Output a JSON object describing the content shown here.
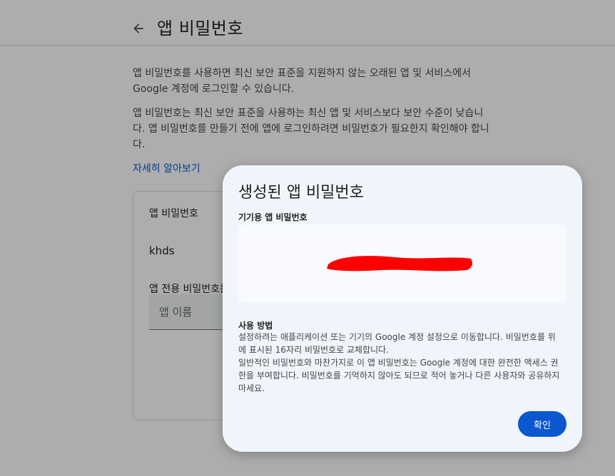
{
  "page": {
    "title": "앱 비밀번호",
    "back_icon": "arrow-left-icon"
  },
  "intro": {
    "paragraph1": "앱 비밀번호를 사용하면 최신 보안 표준을 지원하지 않는 오래된 앱 및 서비스에서 Google 계정에 로그인할 수 있습니다.",
    "paragraph2": "앱 비밀번호는 최신 보안 표준을 사용하는 최신 앱 및 서비스보다 보안 수준이 낮습니다. 앱 비밀번호를 만들기 전에 앱에 로그인하려면 비밀번호가 필요한지 확인해야 합니다.",
    "learn_more": "자세히 알아보기"
  },
  "card": {
    "title": "앱 비밀번호",
    "app_name": "khds",
    "field_label": "앱 전용 비밀번호를",
    "input_placeholder": "앱 이름"
  },
  "dialog": {
    "title": "생성된 앱 비밀번호",
    "password_label": "기기용 앱 비밀번호",
    "redaction_color": "#ff0000",
    "howto_title": "사용 방법",
    "howto_line1": "설정하려는 애플리케이션 또는 기기의 Google 계정 설정으로 이동합니다. 비밀번호를 위에 표시된 16자리 비밀번호로 교체합니다.",
    "howto_line2": "일반적인 비밀번호와 마찬가지로 이 앱 비밀번호는 Google 계정에 대한 완전한 액세스 권한을 부여합니다. 비밀번호를 기억하지 않아도 되므로 적어 놓거나 다른 사용자와 공유하지 마세요.",
    "confirm_label": "확인"
  },
  "colors": {
    "accent": "#0b57d0",
    "dialog_bg": "#f0f4fb",
    "scrim": "rgba(0,0,0,0.32)"
  }
}
